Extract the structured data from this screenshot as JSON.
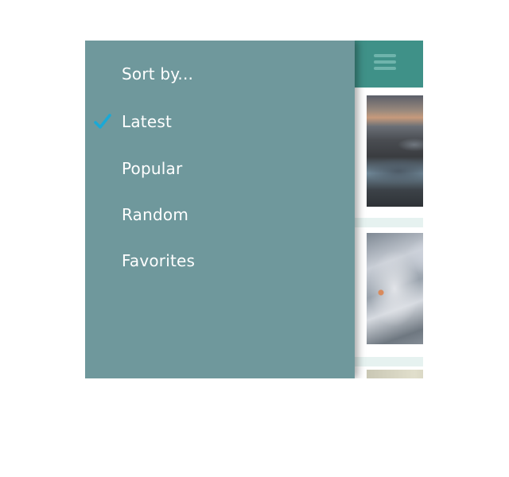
{
  "drawer": {
    "title": "Sort by...",
    "options": [
      {
        "label": "Latest",
        "selected": true
      },
      {
        "label": "Popular",
        "selected": false
      },
      {
        "label": "Random",
        "selected": false
      },
      {
        "label": "Favorites",
        "selected": false
      }
    ],
    "check_icon": "checkmark-icon",
    "check_color": "#1aa9d6",
    "background_color": "#6f989c"
  },
  "app": {
    "header_color": "#3f9188",
    "menu_icon": "hamburger-menu-icon",
    "feed_background": "#e6f2f0"
  }
}
